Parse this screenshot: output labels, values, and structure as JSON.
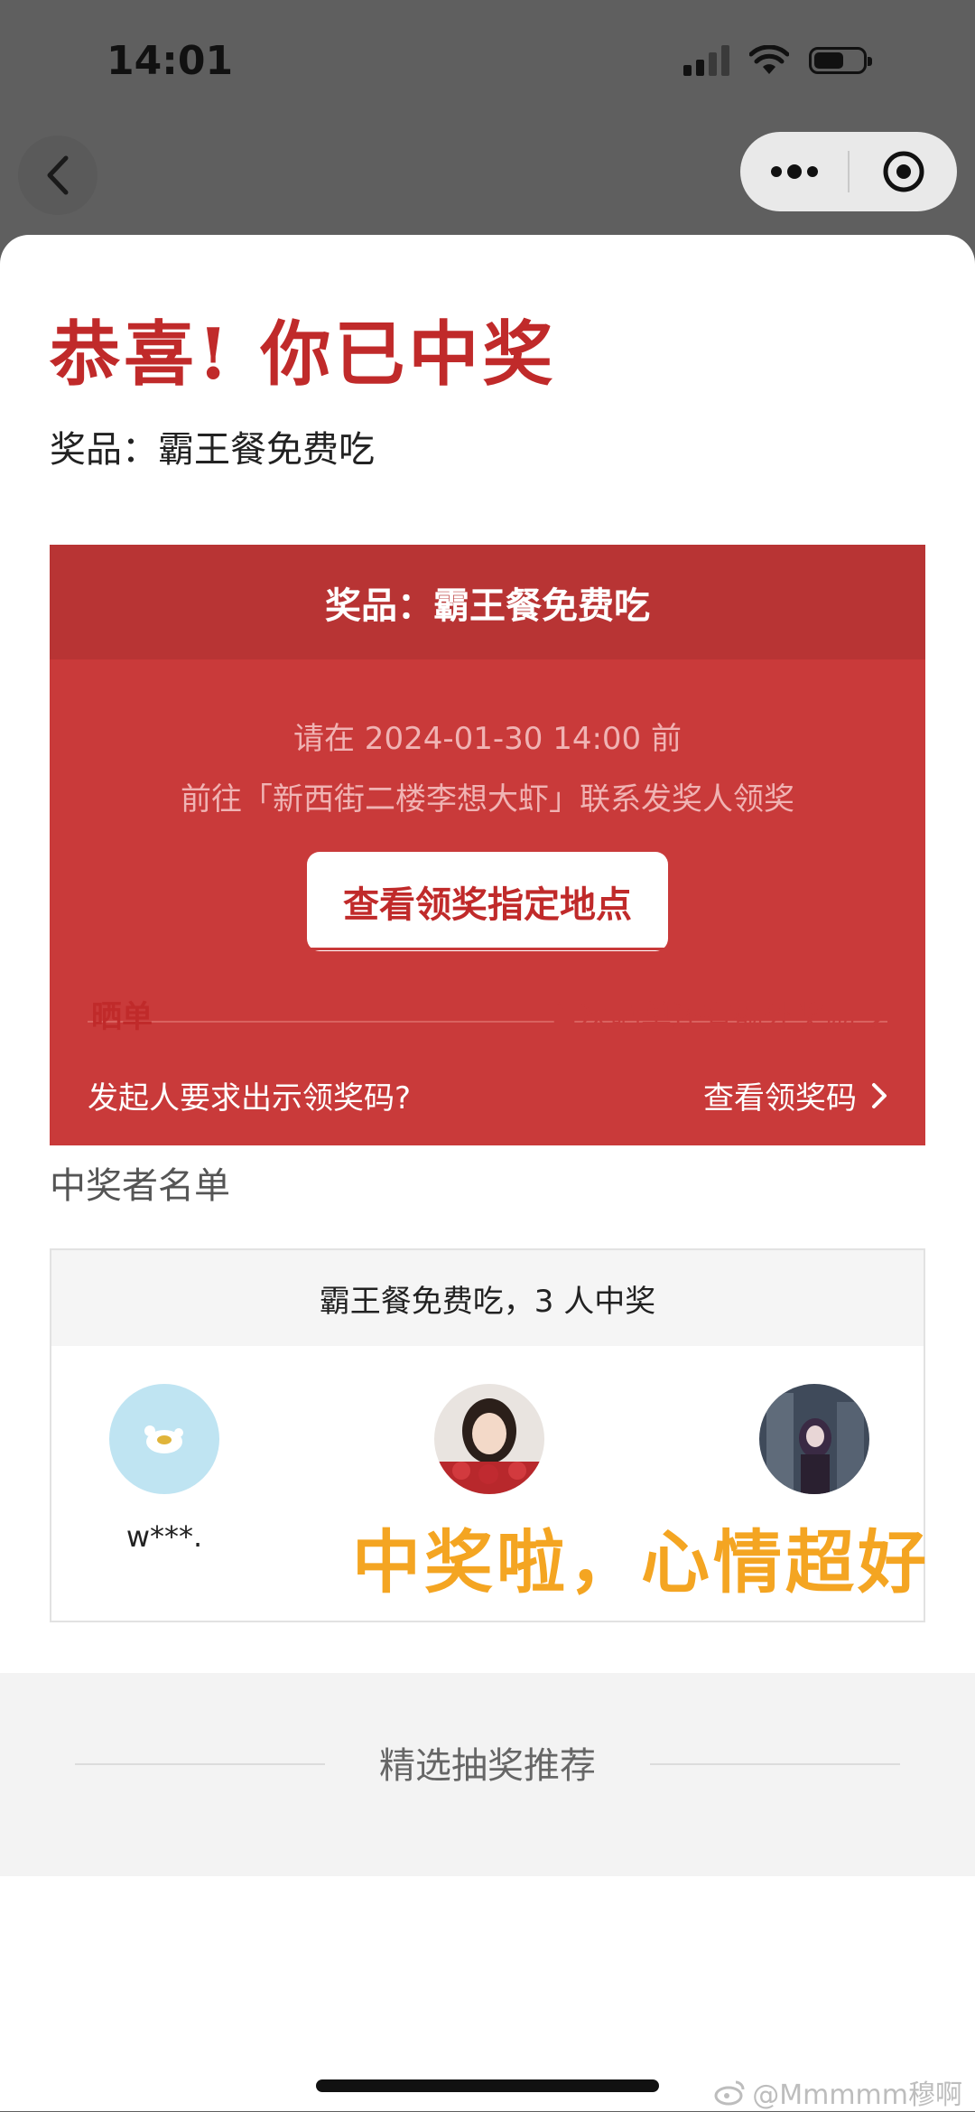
{
  "status_bar": {
    "time": "14:01"
  },
  "congrats_title": "恭喜! 你已中奖",
  "prize_line": "奖品：霸王餐免费吃",
  "prize_card": {
    "header": "奖品：霸王餐免费吃",
    "deadline_line": "请在 2024-01-30 14:00 前",
    "location_line": "前往「新西街二楼李想大虾」联系发奖人领奖",
    "location_button": "查看领奖指定地点",
    "code_question": "发起人要求出示领奖码?",
    "code_link": "查看领奖码"
  },
  "share": {
    "label": "晒单",
    "bonus": "首次晒单还有额外奖励"
  },
  "winners": {
    "section_title": "中奖者名单",
    "summary": "霸王餐免费吃，3 人中奖",
    "list": [
      {
        "name": "w***."
      },
      {
        "name": ""
      },
      {
        "name": ""
      }
    ]
  },
  "overlay_caption": "中奖啦，心情超好",
  "recommendations_title": "精选抽奖推荐",
  "watermark": "@Mmmmm穆啊",
  "colors": {
    "accent": "#c93a3a",
    "overlay": "#f4a522"
  }
}
